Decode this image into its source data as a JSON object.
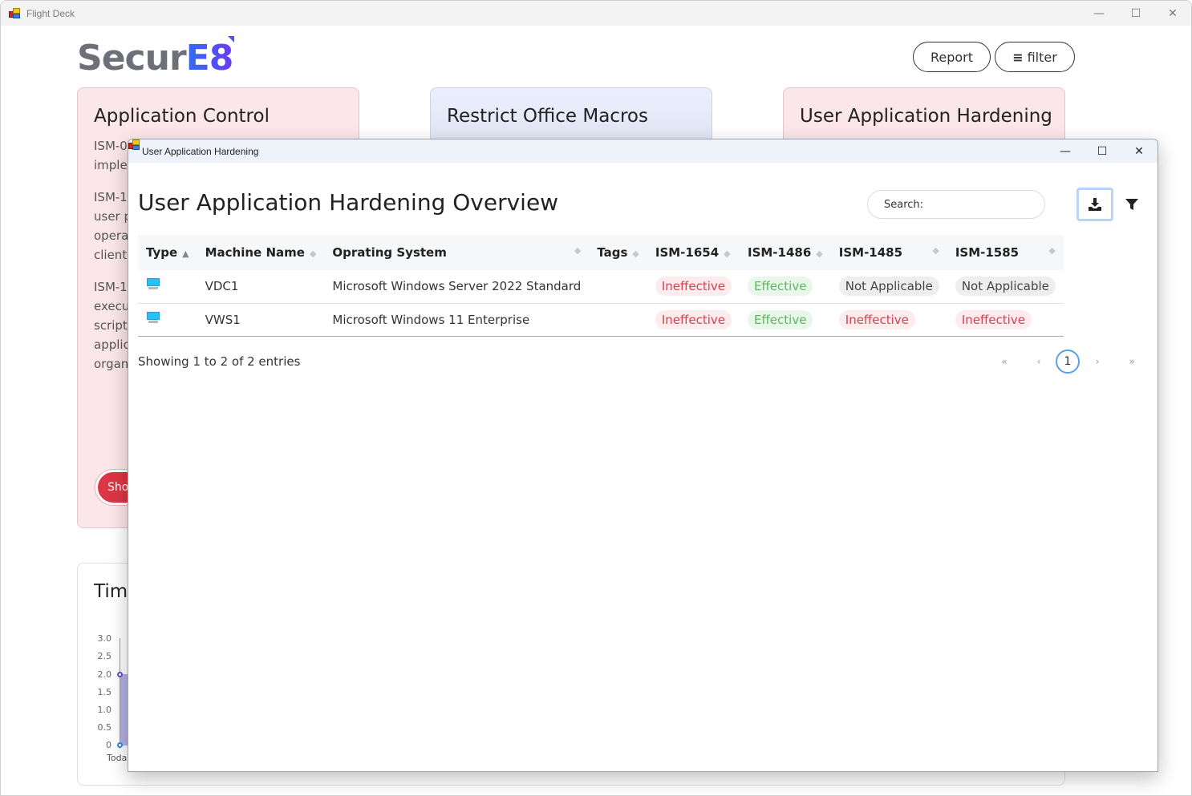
{
  "window": {
    "title": "Flight Deck",
    "controls": {
      "minimize": "—",
      "maximize": "☐",
      "close": "✕"
    }
  },
  "header": {
    "logo_text": "Secur",
    "logo_accent": "E8",
    "report_label": "Report",
    "filter_label": "filter",
    "filter_icon": "≡"
  },
  "cards": [
    {
      "title": "Application Control",
      "paragraphs": [
        "ISM-0",
        "impler",
        "ISM-1",
        "user p",
        "opera",
        "clients",
        "ISM-1",
        "execu",
        "scripts",
        "applic",
        "organ"
      ],
      "button_label": "Show"
    },
    {
      "title": "Restrict Office Macros"
    },
    {
      "title": "User Application Hardening"
    }
  ],
  "timeline": {
    "title": "Tim",
    "y_ticks": [
      "3.0",
      "2.5",
      "2.0",
      "1.5",
      "1.0",
      "0.5",
      "0"
    ],
    "x_label": "Toda"
  },
  "modal": {
    "title": "User Application Hardening",
    "heading": "User Application Hardening Overview",
    "search_placeholder": "Search:",
    "download_icon": "download-icon",
    "filter_icon": "filter-icon",
    "columns": [
      "Type",
      "Machine Name",
      "Oprating System",
      "Tags",
      "ISM-1654",
      "ISM-1486",
      "ISM-1485",
      "ISM-1585"
    ],
    "rows": [
      {
        "type": "computer",
        "machine": "VDC1",
        "os": "Microsoft Windows Server 2022 Standard",
        "tags": "",
        "ism1654": "Ineffective",
        "ism1486": "Effective",
        "ism1485": "Not Applicable",
        "ism1585": "Not Applicable"
      },
      {
        "type": "computer",
        "machine": "VWS1",
        "os": "Microsoft Windows 11 Enterprise",
        "tags": "",
        "ism1654": "Ineffective",
        "ism1486": "Effective",
        "ism1485": "Ineffective",
        "ism1585": "Ineffective"
      }
    ],
    "info": "Showing 1 to 2 of 2 entries",
    "pagination": {
      "first": "«",
      "prev": "‹",
      "current": "1",
      "next": "›",
      "last": "»"
    }
  },
  "colors": {
    "ineffective": "#d9404f",
    "effective": "#5cb85c",
    "accent": "#3d5af1"
  }
}
